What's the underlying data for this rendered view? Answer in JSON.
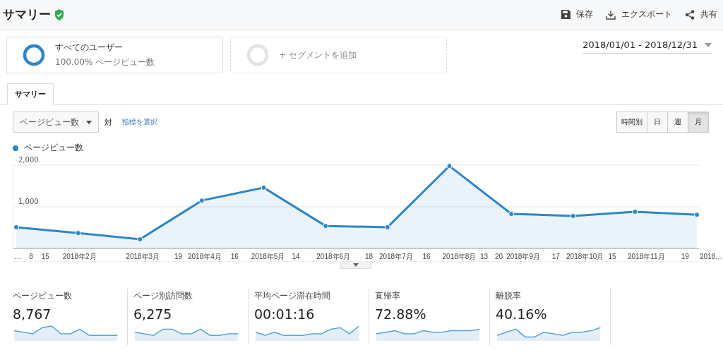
{
  "header": {
    "title": "サマリー",
    "actions": [
      {
        "kind": "save",
        "label": "保存"
      },
      {
        "kind": "export",
        "label": "エクスポート"
      },
      {
        "kind": "share",
        "label": "共有"
      }
    ]
  },
  "segments": [
    {
      "kind": "active",
      "name": "すべてのユーザー",
      "detail": "100.00% ページビュー数"
    },
    {
      "kind": "add",
      "name": "+ セグメントを追加"
    }
  ],
  "date_range": "2018/01/01 - 2018/12/31",
  "tabs": [
    {
      "label": "サマリー",
      "selected": true
    }
  ],
  "metric_selector": {
    "value": "ページビュー数",
    "versus": "対",
    "link": "指標を選択"
  },
  "granularity": [
    {
      "label": "時間別",
      "selected": false
    },
    {
      "label": "日",
      "selected": false
    },
    {
      "label": "週",
      "selected": false
    },
    {
      "label": "月",
      "selected": true
    }
  ],
  "chart": {
    "chart_data": {
      "type": "area",
      "categories": [
        "…",
        "2018年2月",
        "2018年3月",
        "2018年4月",
        "2018年5月",
        "2018年6月",
        "2018年7月",
        "2018年8月",
        "2018年9月",
        "2018年10月",
        "2018年11月",
        "2018…"
      ],
      "series": [
        {
          "name": "ページビュー数",
          "color": "#2e86c8",
          "values": [
            510,
            370,
            220,
            1150,
            1460,
            540,
            510,
            1980,
            830,
            780,
            880,
            810
          ]
        }
      ],
      "ylim": [
        0,
        2000
      ],
      "yticks": [
        {
          "value": 1000,
          "label": "1,000"
        },
        {
          "value": 2000,
          "label": "2,000"
        }
      ],
      "xlabel": null
    },
    "day_labels": [
      "8",
      "15",
      "19",
      "16",
      "14",
      "18",
      "16",
      "13",
      "20",
      "17",
      "15",
      "19"
    ]
  },
  "metrics": [
    {
      "label": "ページビュー数",
      "value": "8,767"
    },
    {
      "label": "ページ別訪問数",
      "value": "6,275"
    },
    {
      "label": "平均ページ滞在時間",
      "value": "00:01:16"
    },
    {
      "label": "直帰率",
      "value": "72.88%"
    },
    {
      "label": "離脱率",
      "value": "40.16%"
    }
  ]
}
